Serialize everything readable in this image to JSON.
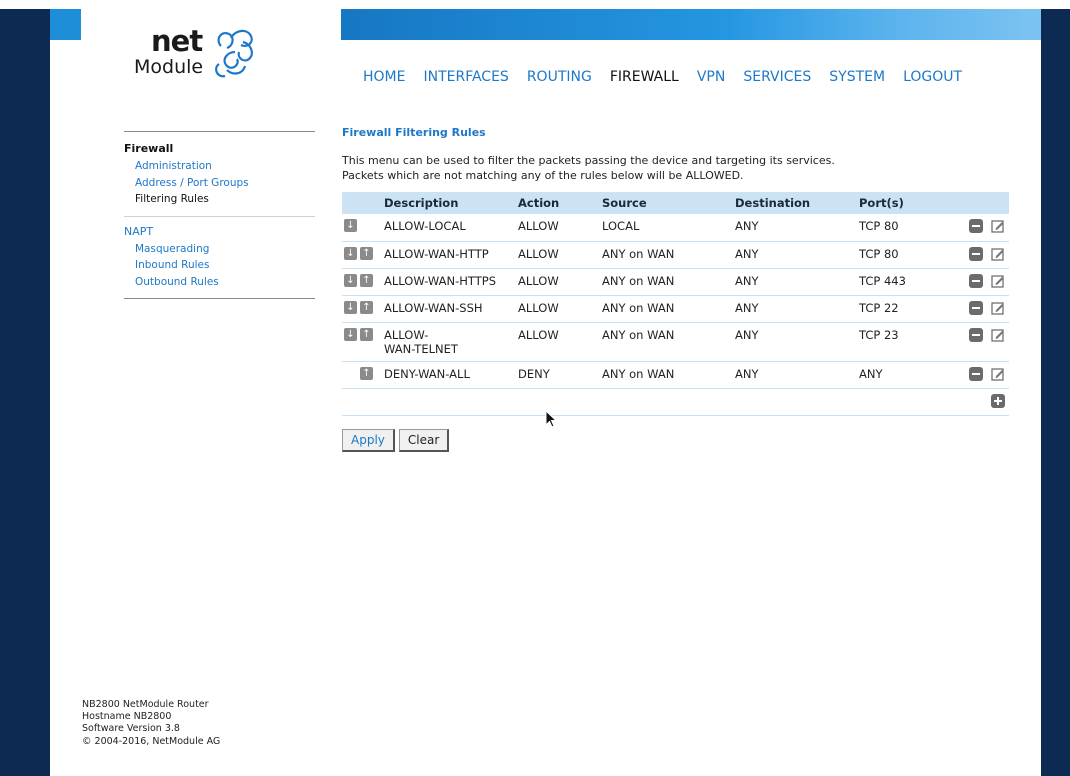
{
  "logo": {
    "top": "net",
    "bottom": "Module"
  },
  "nav": [
    "HOME",
    "INTERFACES",
    "ROUTING",
    "FIREWALL",
    "VPN",
    "SERVICES",
    "SYSTEM",
    "LOGOUT"
  ],
  "nav_active": "FIREWALL",
  "sidebar": {
    "firewall": {
      "title": "Firewall",
      "items": [
        "Administration",
        "Address / Port Groups",
        "Filtering Rules"
      ],
      "current": "Filtering Rules"
    },
    "napt": {
      "title": "NAPT",
      "items": [
        "Masquerading",
        "Inbound Rules",
        "Outbound Rules"
      ]
    }
  },
  "footer": {
    "line1": "NB2800 NetModule Router",
    "line2": "Hostname NB2800",
    "line3": "Software Version 3.8",
    "line4": "© 2004-2016, NetModule AG"
  },
  "page": {
    "title": "Firewall Filtering Rules",
    "desc1": "This menu can be used to filter the packets passing the device and targeting its services.",
    "desc2": "Packets which are not matching any of the rules below will be ALLOWED."
  },
  "table": {
    "headers": {
      "description": "Description",
      "action": "Action",
      "source": "Source",
      "destination": "Destination",
      "ports": "Port(s)"
    },
    "rows": [
      {
        "description": "ALLOW-LOCAL",
        "action": "ALLOW",
        "source": "LOCAL",
        "destination": "ANY",
        "ports": "TCP 80"
      },
      {
        "description": "ALLOW-WAN-HTTP",
        "action": "ALLOW",
        "source": "ANY on WAN",
        "destination": "ANY",
        "ports": "TCP 80"
      },
      {
        "description": "ALLOW-WAN-HTTPS",
        "action": "ALLOW",
        "source": "ANY on WAN",
        "destination": "ANY",
        "ports": "TCP 443"
      },
      {
        "description": "ALLOW-WAN-SSH",
        "action": "ALLOW",
        "source": "ANY on WAN",
        "destination": "ANY",
        "ports": "TCP 22"
      },
      {
        "description": "ALLOW-WAN-TELNET",
        "description_line1": "ALLOW-",
        "description_line2": "WAN-TELNET",
        "action": "ALLOW",
        "source": "ANY on WAN",
        "destination": "ANY",
        "ports": "TCP 23"
      },
      {
        "description": "DENY-WAN-ALL",
        "action": "DENY",
        "source": "ANY on WAN",
        "destination": "ANY",
        "ports": "ANY"
      }
    ]
  },
  "buttons": {
    "apply": "Apply",
    "clear": "Clear"
  },
  "colors": {
    "frame": "#0d2b52",
    "link": "#1e78c8",
    "header_bg": "#cbe3f5"
  }
}
